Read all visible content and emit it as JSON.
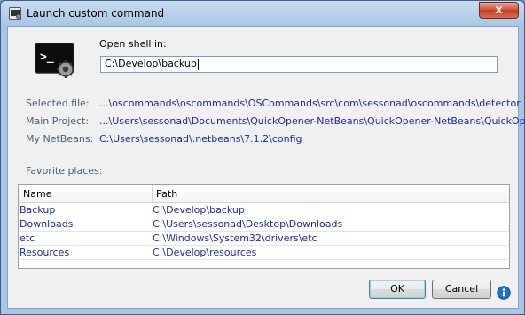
{
  "window": {
    "title": "Launch custom command",
    "close_label": "x"
  },
  "form": {
    "open_shell_label": "Open shell in:",
    "shell_path_value": "C:\\Develop\\backup"
  },
  "info": {
    "selected_file_label": "Selected file:",
    "selected_file_value": "...\\oscommands\\oscommands\\OSCommands\\src\\com\\sessonad\\oscommands\\detector",
    "main_project_label": "Main Project:",
    "main_project_value": "...\\Users\\sessonad\\Documents\\QuickOpener-NetBeans\\QuickOpener-NetBeans\\QuickOpener",
    "netbeans_label": "My NetBeans:",
    "netbeans_value": "C:\\Users\\sessonad\\.netbeans\\7.1.2\\config"
  },
  "favorites": {
    "label": "Favorite places:",
    "columns": {
      "name": "Name",
      "path": "Path"
    },
    "rows": [
      {
        "name": "Backup",
        "path": "C:\\Develop\\backup"
      },
      {
        "name": "Downloads",
        "path": "C:\\Users\\sessonad\\Desktop\\Downloads"
      },
      {
        "name": "etc",
        "path": "C:\\Windows\\System32\\drivers\\etc"
      },
      {
        "name": "Resources",
        "path": "C:\\Develop\\resources"
      }
    ]
  },
  "buttons": {
    "ok": "OK",
    "cancel": "Cancel"
  },
  "icons": {
    "app": "terminal-icon",
    "info": "info-icon",
    "close": "close-icon"
  },
  "colors": {
    "link_text": "#1c2aa3",
    "label_text": "#4b5f77",
    "close_button": "#c23b26"
  }
}
